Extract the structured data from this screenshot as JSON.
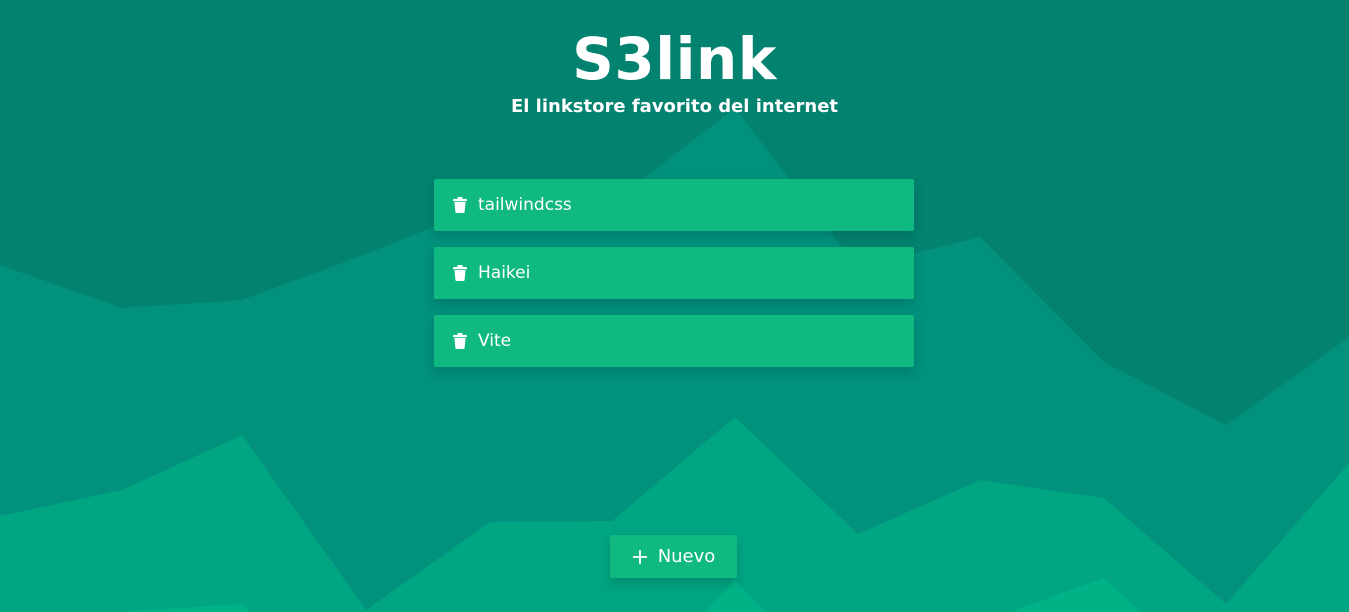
{
  "header": {
    "title": "S3link",
    "subtitle": "El linkstore favorito del internet"
  },
  "links": [
    {
      "label": "tailwindcss",
      "icon": "trash-icon"
    },
    {
      "label": "Haikei",
      "icon": "trash-icon"
    },
    {
      "label": "Vite",
      "icon": "trash-icon"
    }
  ],
  "actions": {
    "new_label": "Nuevo",
    "new_icon": "plus-icon"
  },
  "colors": {
    "background_top": "#03826f",
    "card": "#10b981",
    "text": "#ffffff"
  }
}
